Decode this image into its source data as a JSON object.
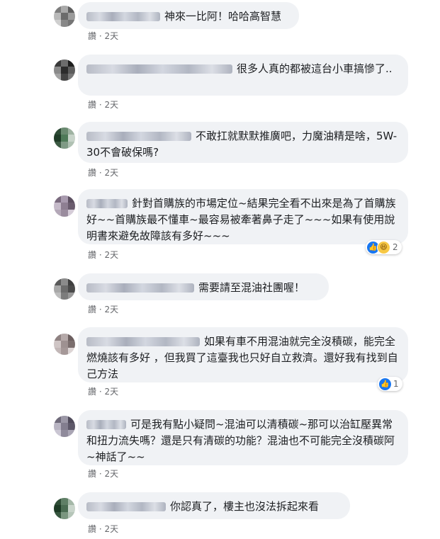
{
  "reply_label": "",
  "like_label": "讚",
  "separator": "·",
  "comments": [
    {
      "text": "神來一比阿！哈哈高智慧",
      "time": "2天",
      "avatar_colors": [
        "#7d7d7d",
        "#a9a9a9",
        "#5e5e5e",
        "#b9b9b9",
        "#6b6b6b",
        "#9b9b9b",
        "#cfcfcf",
        "#888888",
        "#757575"
      ]
    },
    {
      "text": "很多人真的都被這台小車搞慘了..",
      "time": "2天",
      "avatar_colors": [
        "#3a3a3a",
        "#6d6d6d",
        "#1e1e1e",
        "#8a8a8a",
        "#2c2c2c",
        "#5c5c5c",
        "#a4a4a4",
        "#444444",
        "#777777"
      ]
    },
    {
      "text": "不敢扛就默默推廣吧，力魔油精是啥，5W-30不會破保嗎?",
      "time": "2天",
      "avatar_colors": [
        "#2d4a34",
        "#6a8a70",
        "#9fb3a2",
        "#1f3b27",
        "#4e7a58",
        "#c7d3c9",
        "#3c5a43",
        "#7f9a85",
        "#b0c1b3"
      ]
    },
    {
      "text": "針對首購族的市場定位~結果完全看不出來是為了首購族好~~首購族最不懂車~最容易被牽著鼻子走了~~~如果有使用說明書來避免故障該有多好~~~",
      "time": "2天",
      "reaction_count": "2",
      "avatar_colors": [
        "#7a6a7e",
        "#a89aae",
        "#5c4f60",
        "#c5bac9",
        "#8e7f92",
        "#6a5c6e",
        "#b4a8b8",
        "#9a8c9e",
        "#d5ccd8"
      ]
    },
    {
      "text": "需要請至混油社團喔！",
      "time": "2天",
      "avatar_colors": [
        "#5a5a5a",
        "#8b8b8b",
        "#3f3f3f",
        "#a8a8a8",
        "#6c6c6c",
        "#4a4a4a",
        "#bdbdbd",
        "#7c7c7c",
        "#999999"
      ]
    },
    {
      "text": "如果有車不用混油就完全沒積碳，能完全燃燒該有多好 ，但我買了這臺我也只好自立救濟。還好我有找到自己方法",
      "time": "2天",
      "reaction_count": "1",
      "avatar_colors": [
        "#8f8282",
        "#b5a9a9",
        "#6c5f5f",
        "#cfc5c5",
        "#9e9191",
        "#7a6d6d",
        "#c2b7b7",
        "#a59898",
        "#ddd5d5"
      ]
    },
    {
      "text": "可是我有點小疑問~混油可以清積碳~那可以治缸壓異常和扭力流失嗎？還是只有清碳的功能？混油也不可能完全沒積碳阿~神話了~~",
      "time": "2天",
      "avatar_colors": [
        "#6f6a7a",
        "#9b97a6",
        "#4f4a5a",
        "#b8b4c2",
        "#837e8f",
        "#5d5869",
        "#cac6d3",
        "#8f8a9b",
        "#a9a5b4"
      ]
    },
    {
      "text": "你認真了，樓主也沒法拆起來看",
      "time": "2天",
      "avatar_colors": [
        "#2f4d36",
        "#5f7f66",
        "#a5b8a8",
        "#1d3a25",
        "#4a6c52",
        "#c8d4ca",
        "#37573f",
        "#7a967f",
        "#b6c6b9"
      ]
    }
  ]
}
